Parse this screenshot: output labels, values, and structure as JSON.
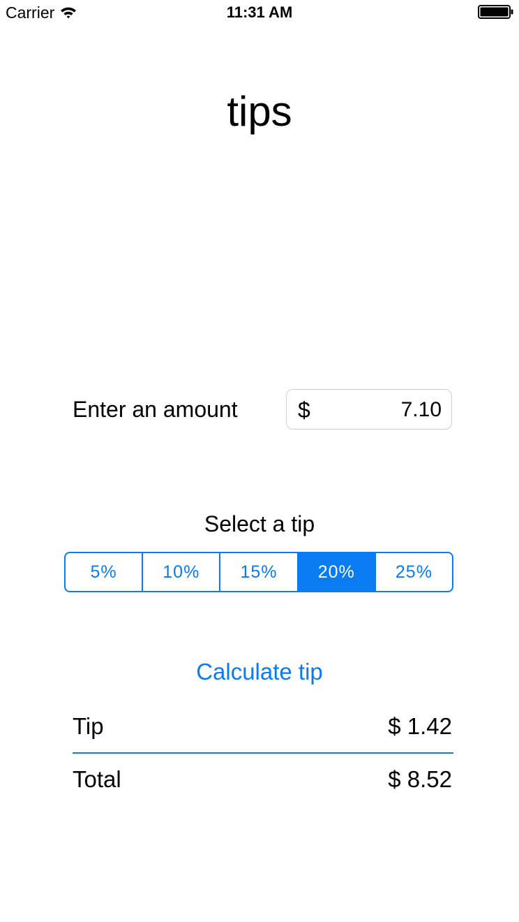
{
  "status_bar": {
    "carrier": "Carrier",
    "time": "11:31 AM",
    "wifi_icon": "wifi-icon",
    "battery_icon": "battery-icon"
  },
  "app": {
    "title": "tips"
  },
  "amount": {
    "label": "Enter an amount",
    "currency": "$",
    "value": "7.10"
  },
  "tip_selector": {
    "label": "Select a tip",
    "options": [
      "5%",
      "10%",
      "15%",
      "20%",
      "25%"
    ],
    "selected": "20%"
  },
  "calculate": {
    "label": "Calculate tip"
  },
  "results": {
    "tip_label": "Tip",
    "tip_value": "$ 1.42",
    "total_label": "Total",
    "total_value": "$ 8.52"
  },
  "colors": {
    "accent": "#0a7bf0",
    "field_border": "#cfcfcf",
    "background": "#ffffff",
    "text": "#000000"
  }
}
